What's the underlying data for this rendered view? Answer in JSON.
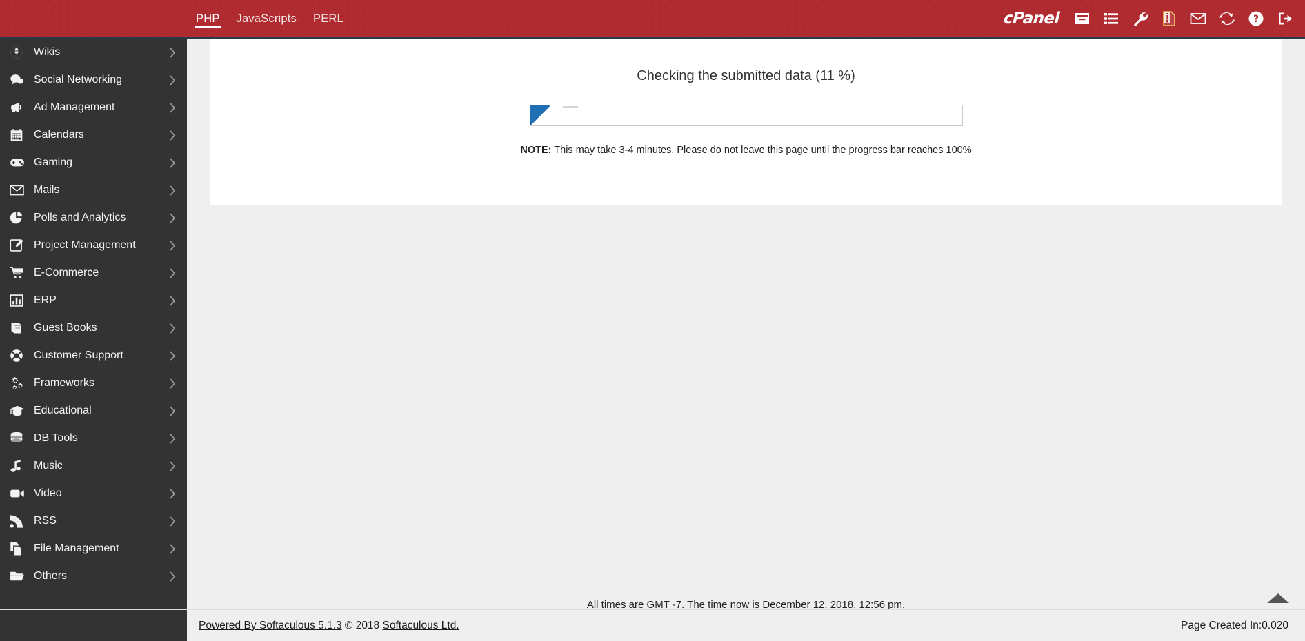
{
  "topbar": {
    "brand": "cPanel",
    "tabs": [
      {
        "label": "PHP",
        "active": true
      },
      {
        "label": "JavaScripts",
        "active": false
      },
      {
        "label": "PERL",
        "active": false
      }
    ],
    "icons": [
      {
        "name": "archive-box-icon",
        "title": "Backups"
      },
      {
        "name": "list-icon",
        "title": "All Installations"
      },
      {
        "name": "wrench-icon",
        "title": "Settings"
      },
      {
        "name": "file-zip-icon",
        "title": "Import"
      },
      {
        "name": "envelope-icon",
        "title": "Mail"
      },
      {
        "name": "sync-refresh-icon",
        "title": "Refresh"
      },
      {
        "name": "help-circle-icon",
        "title": "Help"
      },
      {
        "name": "logout-icon",
        "title": "Logout"
      }
    ],
    "accent_color": "#b02b30",
    "border_color": "#2b3a47"
  },
  "sidebar": {
    "background_color": "#333333",
    "items": [
      {
        "label": "Wikis",
        "icon": "globe-icon"
      },
      {
        "label": "Social Networking",
        "icon": "chat-bubbles-icon"
      },
      {
        "label": "Ad Management",
        "icon": "megaphone-icon"
      },
      {
        "label": "Calendars",
        "icon": "calendar-icon"
      },
      {
        "label": "Gaming",
        "icon": "gamepad-icon"
      },
      {
        "label": "Mails",
        "icon": "envelope-icon"
      },
      {
        "label": "Polls and Analytics",
        "icon": "pie-chart-icon"
      },
      {
        "label": "Project Management",
        "icon": "pencil-square-icon"
      },
      {
        "label": "E-Commerce",
        "icon": "shopping-cart-icon"
      },
      {
        "label": "ERP",
        "icon": "bar-chart-icon"
      },
      {
        "label": "Guest Books",
        "icon": "book-icon"
      },
      {
        "label": "Customer Support",
        "icon": "lifebuoy-icon"
      },
      {
        "label": "Frameworks",
        "icon": "gears-icon"
      },
      {
        "label": "Educational",
        "icon": "graduation-cap-icon"
      },
      {
        "label": "DB Tools",
        "icon": "database-icon"
      },
      {
        "label": "Music",
        "icon": "music-note-icon"
      },
      {
        "label": "Video",
        "icon": "video-camera-icon"
      },
      {
        "label": "RSS",
        "icon": "rss-icon"
      },
      {
        "label": "File Management",
        "icon": "copy-files-icon"
      },
      {
        "label": "Others",
        "icon": "folder-open-icon"
      }
    ]
  },
  "main": {
    "progress": {
      "title": "Checking the submitted data (11 %)",
      "percent": 11,
      "note_prefix": "NOTE:",
      "note_text": "This may take 3-4 minutes. Please do not leave this page until the progress bar reaches 100%",
      "fill_color": "#1f6fb5"
    },
    "gmt_line": "All times are GMT -7. The time now is December 12, 2018, 12:56 pm.",
    "scroll_top_label": "Scroll to top"
  },
  "footer": {
    "powered_by": "Powered By Softaculous 5.1.3",
    "copyright": "© 2018",
    "company": "Softaculous Ltd.",
    "page_created": "Page Created In:0.020"
  }
}
